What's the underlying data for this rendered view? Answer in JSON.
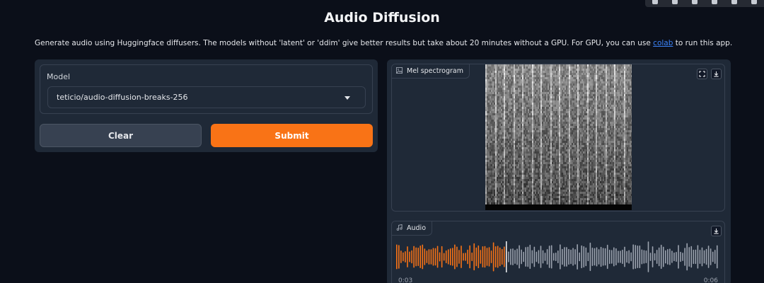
{
  "header": {
    "title": "Audio Diffusion",
    "description_before_link": "Generate audio using Huggingface diffusers. The models without 'latent' or 'ddim' give better results but take about 20 minutes without a GPU. For GPU, you can use ",
    "link_text": "colab",
    "description_after_link": " to run this app."
  },
  "inputs": {
    "model_label": "Model",
    "model_value": "teticio/audio-diffusion-breaks-256",
    "clear_label": "Clear",
    "submit_label": "Submit"
  },
  "outputs": {
    "spectrogram_label": "Mel spectrogram",
    "audio_label": "Audio",
    "time_current": "0:03",
    "time_total": "0:06",
    "playback_progress": 0.34
  },
  "toolbar_icons": [
    "toolbar-icon-1",
    "toolbar-icon-2",
    "toolbar-icon-3",
    "toolbar-icon-4",
    "toolbar-icon-5",
    "toolbar-icon-6"
  ],
  "colors": {
    "accent": "#f97316",
    "link": "#3b82f6",
    "background": "#0b0f19",
    "panel": "#1f2937",
    "waveform_unplayed": "#9ca3af"
  }
}
